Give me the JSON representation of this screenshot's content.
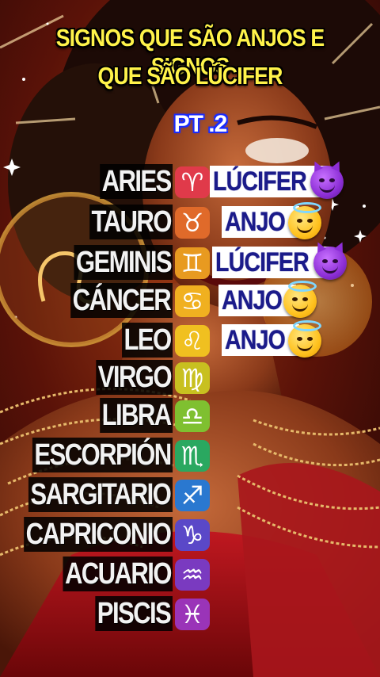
{
  "title_line1": "SIGNOS QUE SÃO ANJOS E SIGNOS",
  "title_line2": "QUE SÃO LÚCIFER",
  "part": "PT .2",
  "signs": [
    {
      "name": "ARIES",
      "symbol": "♈",
      "color": "#e03a4a",
      "answer": "LÚCIFER",
      "emoji": "devil-emoji"
    },
    {
      "name": "TAURO",
      "symbol": "♉",
      "color": "#e06a2a",
      "answer": "ANJO",
      "emoji": "angel-emoji"
    },
    {
      "name": "GEMINIS",
      "symbol": "♊",
      "color": "#e89a20",
      "answer": "LÚCIFER",
      "emoji": "devil-emoji"
    },
    {
      "name": "CÁNCER",
      "symbol": "♋",
      "color": "#f0b020",
      "answer": "ANJO",
      "emoji": "angel-emoji"
    },
    {
      "name": "LEO",
      "symbol": "♌",
      "color": "#f0c020",
      "answer": "ANJO",
      "emoji": "angel-emoji"
    },
    {
      "name": "VIRGO",
      "symbol": "♍",
      "color": "#c8c020",
      "answer": "",
      "emoji": ""
    },
    {
      "name": "LIBRA",
      "symbol": "♎",
      "color": "#7fc030",
      "answer": "",
      "emoji": ""
    },
    {
      "name": "ESCORPIÓN",
      "symbol": "♏",
      "color": "#2aa860",
      "answer": "",
      "emoji": ""
    },
    {
      "name": "SARGITARIO",
      "symbol": "♐",
      "color": "#2a78d0",
      "answer": "",
      "emoji": ""
    },
    {
      "name": "CAPRICONIO",
      "symbol": "♑",
      "color": "#5a48c8",
      "answer": "",
      "emoji": ""
    },
    {
      "name": "ACUARIO",
      "symbol": "♒",
      "color": "#7a3ac0",
      "answer": "",
      "emoji": ""
    },
    {
      "name": "PISCIS",
      "symbol": "♓",
      "color": "#9a34b8",
      "answer": "",
      "emoji": ""
    }
  ]
}
